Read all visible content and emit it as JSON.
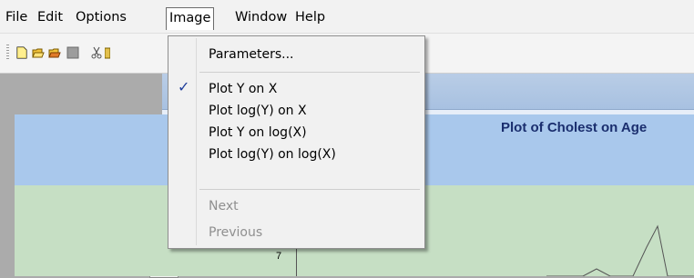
{
  "menubar": {
    "items": [
      "File",
      "Edit",
      "Options",
      "Image",
      "Window",
      "Help"
    ],
    "active_index": 3
  },
  "toolbar": {
    "icons": [
      "new-file-icon",
      "open-folder-icon",
      "open-project-icon",
      "save-icon",
      "cut-icon",
      "paste-icon"
    ]
  },
  "image_menu": {
    "parameters": "Parameters...",
    "options": [
      "Plot Y on  X",
      "Plot log(Y)  on X",
      "Plot Y on log(X)",
      "Plot log(Y) on log(X)"
    ],
    "checked_index": 0,
    "next": "Next",
    "previous": "Previous"
  },
  "plot": {
    "title": "Plot of Cholest on Age",
    "y_tick_visible": "7"
  },
  "colors": {
    "accent_check": "#1f3e9b",
    "plot_header": "#a9c8ec",
    "plot_area": "#c6dfc4",
    "title_text": "#1a2e6e"
  }
}
